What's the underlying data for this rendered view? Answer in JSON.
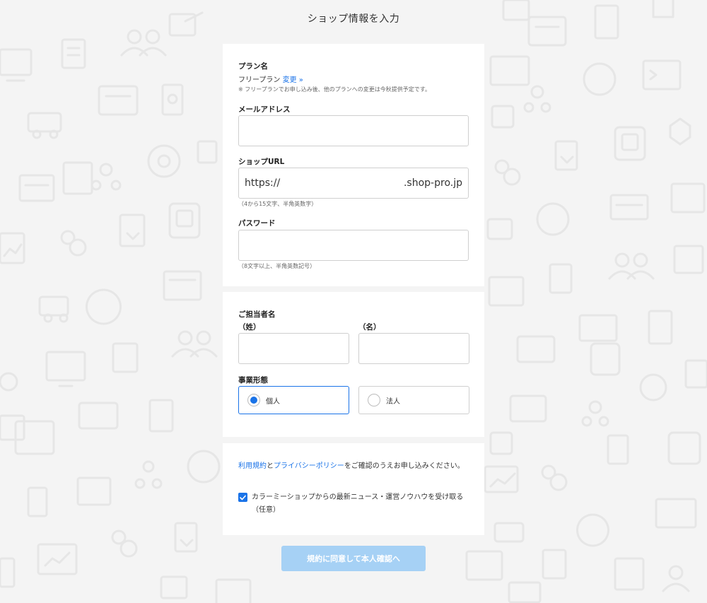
{
  "page": {
    "title": "ショップ情報を入力"
  },
  "plan": {
    "label": "プラン名",
    "value": "フリープラン",
    "change_link": "変更 »",
    "note": "※ フリープランでお申し込み後、他のプランへの変更は今秋提供予定です。"
  },
  "email": {
    "label": "メールアドレス",
    "value": ""
  },
  "shop_url": {
    "label": "ショップURL",
    "prefix": "https://",
    "suffix": ".shop-pro.jp",
    "value": "",
    "note": "（4から15文字、半角英数字）"
  },
  "password": {
    "label": "パスワード",
    "value": "",
    "note": "（8文字以上、半角英数記号）"
  },
  "contact": {
    "label": "ご担当者名",
    "last_name_label": "（姓）",
    "first_name_label": "（名）",
    "last_name_value": "",
    "first_name_value": ""
  },
  "business_type": {
    "label": "事業形態",
    "options": [
      {
        "label": "個人",
        "selected": true
      },
      {
        "label": "法人",
        "selected": false
      }
    ]
  },
  "terms": {
    "terms_link": "利用規約",
    "and": "と",
    "privacy_link": "プライバシーポリシー",
    "suffix": "をご確認のうえお申し込みください。"
  },
  "newsletter": {
    "label": "カラーミーショップからの最新ニュース・運営ノウハウを受け取る（任意）",
    "checked": true
  },
  "submit": {
    "label": "規約に同意して本人確認へ"
  },
  "colors": {
    "accent": "#1a73e8",
    "button_disabled": "#a6d1f5",
    "background": "#f4f4f4"
  }
}
